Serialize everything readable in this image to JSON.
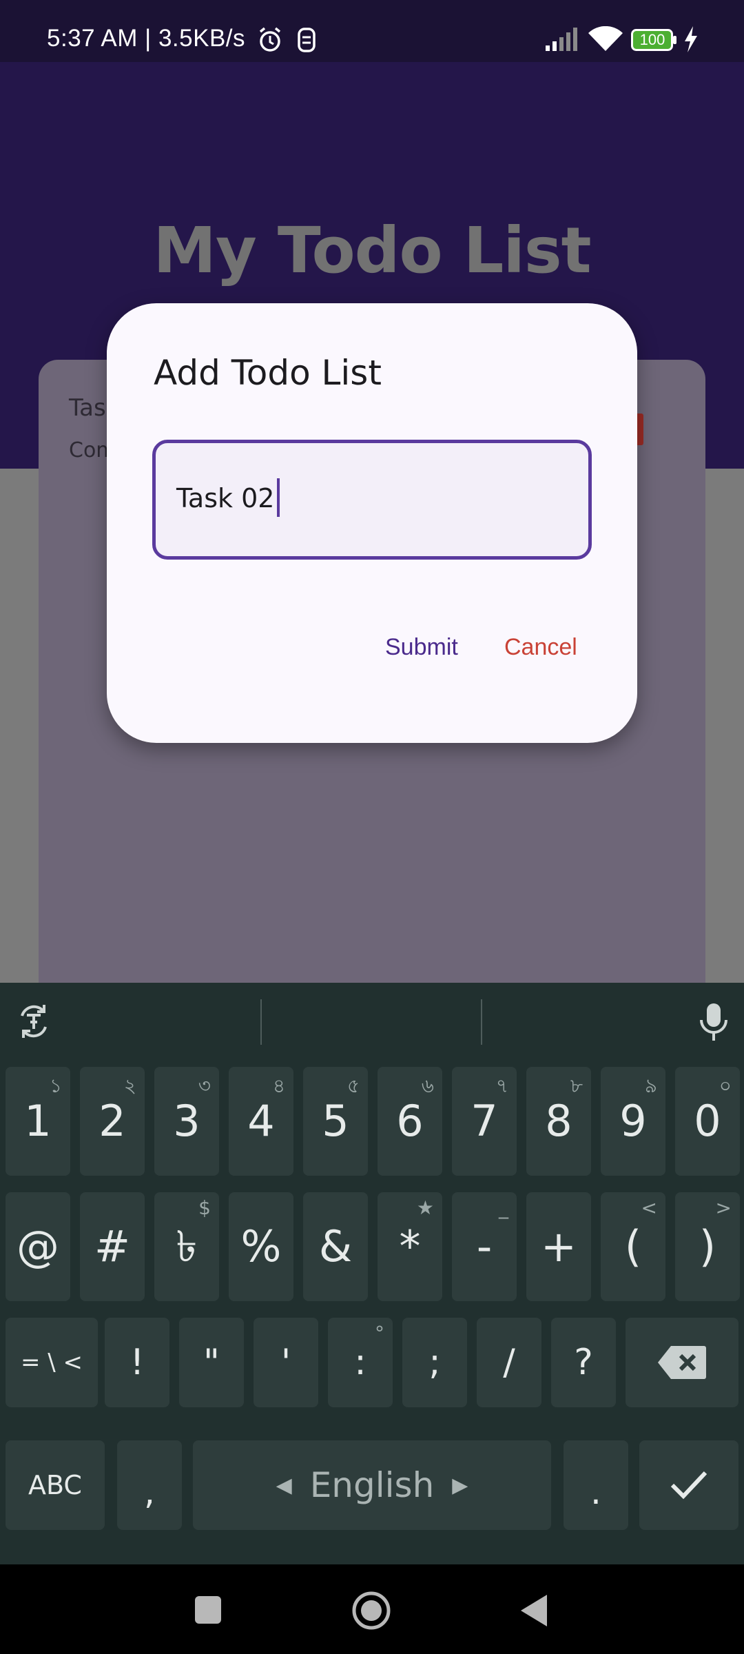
{
  "status_bar": {
    "text": "5:37 AM | 3.5KB/s",
    "battery": "100",
    "icons": [
      "alarm-icon",
      "notification-icon",
      "signal-icon",
      "wifi-icon",
      "battery-icon",
      "charging-icon"
    ]
  },
  "app": {
    "title": "My Todo List",
    "card": {
      "title": "Tas",
      "status": "Com"
    }
  },
  "dialog": {
    "title": "Add Todo List",
    "input_value": "Task 02",
    "submit_label": "Submit",
    "cancel_label": "Cancel"
  },
  "keyboard": {
    "toolbar_icons": [
      "translate-icon",
      "microphone-icon"
    ],
    "row1": [
      {
        "k": "1",
        "h": "১"
      },
      {
        "k": "2",
        "h": "২"
      },
      {
        "k": "3",
        "h": "৩"
      },
      {
        "k": "4",
        "h": "৪"
      },
      {
        "k": "5",
        "h": "৫"
      },
      {
        "k": "6",
        "h": "৬"
      },
      {
        "k": "7",
        "h": "৭"
      },
      {
        "k": "8",
        "h": "৮"
      },
      {
        "k": "9",
        "h": "৯"
      },
      {
        "k": "0",
        "h": "০"
      }
    ],
    "row2": [
      {
        "k": "@",
        "h": ""
      },
      {
        "k": "#",
        "h": ""
      },
      {
        "k": "৳",
        "h": "$"
      },
      {
        "k": "%",
        "h": ""
      },
      {
        "k": "&",
        "h": ""
      },
      {
        "k": "*",
        "h": "★"
      },
      {
        "k": "-",
        "h": "_"
      },
      {
        "k": "+",
        "h": ""
      },
      {
        "k": "(",
        "h": "<"
      },
      {
        "k": ")",
        "h": ">"
      }
    ],
    "row3": [
      {
        "k": "= \\ <",
        "h": ""
      },
      {
        "k": "!",
        "h": ""
      },
      {
        "k": "\"",
        "h": ""
      },
      {
        "k": "'",
        "h": ""
      },
      {
        "k": ":",
        "h": "°"
      },
      {
        "k": ";",
        "h": ""
      },
      {
        "k": "/",
        "h": ""
      },
      {
        "k": "?",
        "h": ""
      }
    ],
    "abc_label": "ABC",
    "comma": ",",
    "space_label": "English",
    "period": ".",
    "colors": {
      "background": "#21302f",
      "key": "#2e3d3c"
    }
  },
  "navbar": {
    "icons": [
      "recents-icon",
      "home-icon",
      "back-icon"
    ]
  },
  "colors": {
    "primary": "#24164a",
    "accent": "#5a3a9e",
    "cancel": "#c94236"
  }
}
